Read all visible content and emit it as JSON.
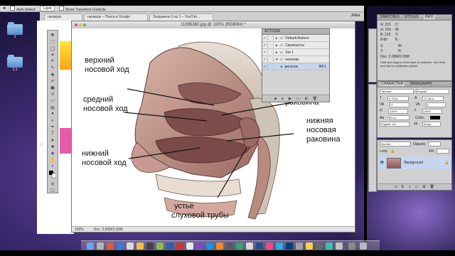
{
  "options_bar": {
    "auto_select_label": "Auto-Select:",
    "auto_select_value": "Layer",
    "transform_label": "Show Transform Controls"
  },
  "browser": {
    "tabs": [
      {
        "label": "насморк"
      },
      {
        "label": "насморк – Поиск в Google"
      },
      {
        "label": "Загружено 0 из 1 – YouTub…"
      }
    ],
    "user_label": "Jeka"
  },
  "desktop_icons": [
    {
      "label": "1"
    },
    {
      "label": "1.1"
    }
  ],
  "document": {
    "title": "11095360.jpg @ 100% (RGB/8#) *",
    "zoom": "100%",
    "doc_size": "Doc: 2.00M/2.00M"
  },
  "figure_labels": {
    "upper": {
      "line1": "верхний",
      "line2": "носовой ход"
    },
    "middle": {
      "line1": "средний",
      "line2": "носовой ход"
    },
    "lower": {
      "line1": "нижний",
      "line2": "носовой ход"
    },
    "middle_concha": {
      "line1": "раковина"
    },
    "lower_concha": {
      "line1": "нижняя",
      "line2": "носовая",
      "line3": "раковина"
    },
    "tube": {
      "line1": "устье",
      "line2": "слуховой трубы"
    }
  },
  "actions_panel": {
    "tab": "ACTIONS",
    "rows": [
      {
        "label": "Default Actions"
      },
      {
        "label": "Скриншоты"
      },
      {
        "label": "Set 1"
      },
      {
        "label": "насморк"
      },
      {
        "label": "рисунок",
        "shortcut": "⌘F1"
      }
    ]
  },
  "info_panel": {
    "tabs": [
      "SWATCHES",
      "STYLES",
      "INFO"
    ],
    "rgb_labels": [
      "R:",
      "G:",
      "B:"
    ],
    "rgb_values": [
      "215",
      "215",
      "215"
    ],
    "rgb2_labels": [
      "C:",
      "M:",
      "Y:",
      "K:"
    ],
    "bit_label": "8-bit",
    "x_label": "X:",
    "y_label": "Y:",
    "w_label": "W:",
    "h_label": "H:",
    "doc_text": "Doc: 2.00M/2.00M",
    "hint": "Click and drag to move layer or selection. Use Shift and Opt for additional options."
  },
  "character_panel": {
    "tabs": [
      "CHARACTER",
      "PARAGRAPH"
    ],
    "font_family": "Tahoma",
    "font_style": "Regular",
    "font_size": "6.78 pt",
    "leading": "11.58 pt",
    "kerning": "0",
    "tracking": "0",
    "vscale": "100%",
    "hscale": "100%",
    "baseline": "0 pt",
    "color_label": "Color:",
    "language": "English: UK",
    "aa": "Sharp"
  },
  "layers_panel": {
    "blend_mode": "Normal",
    "opacity_label": "Opacity:",
    "lock_label": "Lock:",
    "fill_label": "Fill:",
    "layer_name": "Background"
  },
  "colors": {
    "ps_panel_bg": "#d0d0d0",
    "selected_row": "#c5d6ee",
    "dock_tint": "#8d8da0"
  }
}
